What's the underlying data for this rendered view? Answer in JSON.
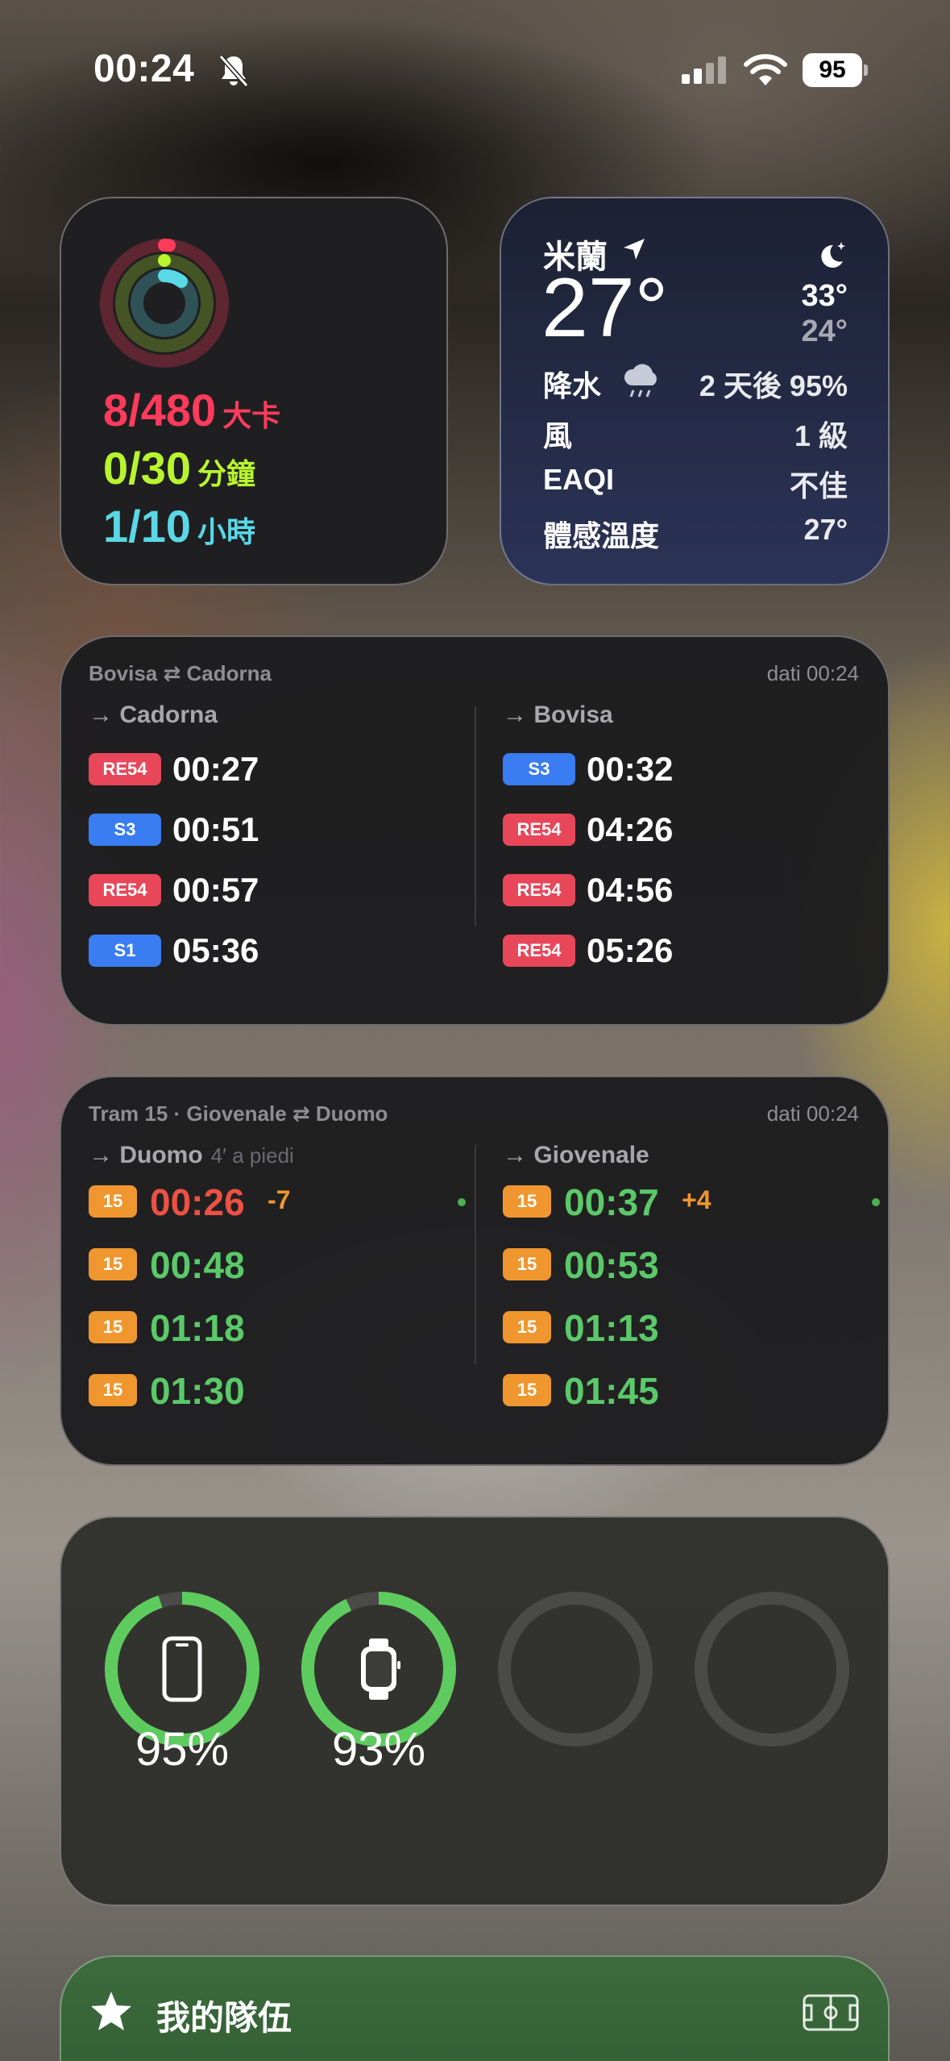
{
  "status_bar": {
    "time": "00:24",
    "battery": "95"
  },
  "activity": {
    "move": {
      "value": "8/480",
      "unit": "大卡",
      "color": "#ff3b5c"
    },
    "exercise": {
      "value": "0/30",
      "unit": "分鐘",
      "color": "#b8f52e"
    },
    "stand": {
      "value": "1/10",
      "unit": "小時",
      "color": "#5ad8e6"
    }
  },
  "weather": {
    "city": "米蘭",
    "temp": "27°",
    "high": "33°",
    "low": "24°",
    "rows": [
      {
        "label": "降水",
        "value": "2 天後 95%"
      },
      {
        "label": "風",
        "value": "1 級"
      },
      {
        "label": "EAQI",
        "value": "不佳"
      },
      {
        "label": "體感溫度",
        "value": "27°"
      }
    ]
  },
  "train": {
    "header": "Bovisa ⇄ Cadorna",
    "updated": "dati 00:24",
    "left": {
      "title": "→ Cadorna",
      "departures": [
        {
          "line": "RE54",
          "color": "red",
          "time": "00:27"
        },
        {
          "line": "S3",
          "color": "blue",
          "time": "00:51"
        },
        {
          "line": "RE54",
          "color": "red",
          "time": "00:57"
        },
        {
          "line": "S1",
          "color": "blue",
          "time": "05:36"
        }
      ]
    },
    "right": {
      "title": "→ Bovisa",
      "departures": [
        {
          "line": "S3",
          "color": "blue",
          "time": "00:32"
        },
        {
          "line": "RE54",
          "color": "red",
          "time": "04:26"
        },
        {
          "line": "RE54",
          "color": "red",
          "time": "04:56"
        },
        {
          "line": "RE54",
          "color": "red",
          "time": "05:26"
        }
      ]
    }
  },
  "tram": {
    "header": "Tram 15 · Giovenale ⇄ Duomo",
    "updated": "dati 00:24",
    "left": {
      "title": "→ Duomo",
      "subtitle": "4′ a piedi",
      "departures": [
        {
          "line": "15",
          "time": "00:26",
          "delta": "-7",
          "late": true
        },
        {
          "line": "15",
          "time": "00:48"
        },
        {
          "line": "15",
          "time": "01:18"
        },
        {
          "line": "15",
          "time": "01:30"
        }
      ]
    },
    "right": {
      "title": "→ Giovenale",
      "departures": [
        {
          "line": "15",
          "time": "00:37",
          "delta": "+4"
        },
        {
          "line": "15",
          "time": "00:53"
        },
        {
          "line": "15",
          "time": "01:13"
        },
        {
          "line": "15",
          "time": "01:45"
        }
      ]
    }
  },
  "batteries": {
    "devices": [
      {
        "icon": "iphone-icon",
        "level": 95,
        "label": "95%"
      },
      {
        "icon": "watch-icon",
        "level": 93,
        "label": "93%"
      },
      {
        "icon": "",
        "level": 0,
        "label": ""
      },
      {
        "icon": "",
        "level": 0,
        "label": ""
      }
    ],
    "ring_color": "#5ecb5e"
  },
  "team": {
    "label": "我的隊伍"
  }
}
